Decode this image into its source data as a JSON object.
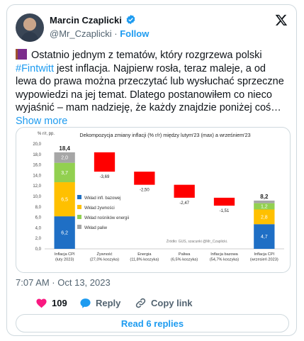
{
  "author": {
    "name": "Marcin Czaplicki",
    "handle": "@Mr_Czaplicki",
    "follow_label": "Follow",
    "verified": true
  },
  "tweet": {
    "emoji": "books-icon",
    "text_part1": "Ostatnio jednym z tematów, który rozgrzewa polski ",
    "hashtag": "#Fintwitt",
    "text_part2": " jest inflacja. Najpierw rosła, teraz maleje, a od lewa do prawa można przeczytać lub wysłuchać sprzeczne wypowiedzi na jej temat. Dlatego postanowiłem co nieco wyjaśnić – mam nadzieję, że każdy znajdzie poniżej coś…",
    "show_more": "Show more"
  },
  "timestamp": "7:07 AM · Oct 13, 2023",
  "actions": {
    "likes": "109",
    "reply_label": "Reply",
    "copy_link_label": "Copy link"
  },
  "read_replies_label": "Read 6 replies",
  "colors": {
    "accent": "#1d9bf0",
    "like": "#f91880",
    "base": "#1f6fc5",
    "food": "#ffc000",
    "energy": "#92d050",
    "fuel": "#a6a6a6",
    "decrease": "#ff0000"
  },
  "chart_data": {
    "type": "bar",
    "title": "Dekompozycja zmiany inflacji (% r/r) między lutym'23 (max) a wrześniem'23",
    "ylabel": "% r/r, pp.",
    "ylim": [
      0,
      20
    ],
    "yticks": [
      "0,0",
      "2,0",
      "4,0",
      "6,0",
      "8,0",
      "10,0",
      "12,0",
      "14,0",
      "16,0",
      "18,0",
      "20,0"
    ],
    "categories": [
      [
        "Inflacja CPI",
        "(luty 2023)"
      ],
      [
        "Żywność",
        "(27,0% koszyka)"
      ],
      [
        "Energia",
        "(11,8% koszyka)"
      ],
      [
        "Paliwa",
        "(6,5% koszyka)"
      ],
      [
        "Inflacja bazowa",
        "(54,7% koszyka)"
      ],
      [
        "Inflacja CPI",
        "(wrzesień 2023)"
      ]
    ],
    "start_bar": {
      "total": "18,4",
      "stack": [
        {
          "name": "Wkład infl. bazowej",
          "value": 6.2,
          "label": "6,2"
        },
        {
          "name": "Wkład żywności",
          "value": 6.5,
          "label": "6,5"
        },
        {
          "name": "Wkład nośników energii",
          "value": 3.7,
          "label": "3,7"
        },
        {
          "name": "Wkład paliw",
          "value": 2.0,
          "label": "2,0"
        }
      ]
    },
    "changes": [
      {
        "value": -3.69,
        "label": "-3,69"
      },
      {
        "value": -2.5,
        "label": "-2,50"
      },
      {
        "value": -2.47,
        "label": "-2,47"
      },
      {
        "value": -1.51,
        "label": "-1,51"
      }
    ],
    "end_bar": {
      "total": "8,2",
      "stack": [
        {
          "name": "Wkład infl. bazowej",
          "value": 4.7,
          "label": "4,7"
        },
        {
          "name": "Wkład żywności",
          "value": 2.8,
          "label": "2,8"
        },
        {
          "name": "Wkład nośników energii",
          "value": 1.2,
          "label": "1,2"
        },
        {
          "name": "Wkład paliw",
          "value": 0.5,
          "label": ""
        }
      ]
    },
    "legend": [
      "Wkład infl. bazowej",
      "Wkład żywności",
      "Wkład nośników energii",
      "Wkład paliw"
    ],
    "legend_position": "left-inside",
    "source": "Źródło: GUS, szacunki @Mr_Czaplicki."
  }
}
